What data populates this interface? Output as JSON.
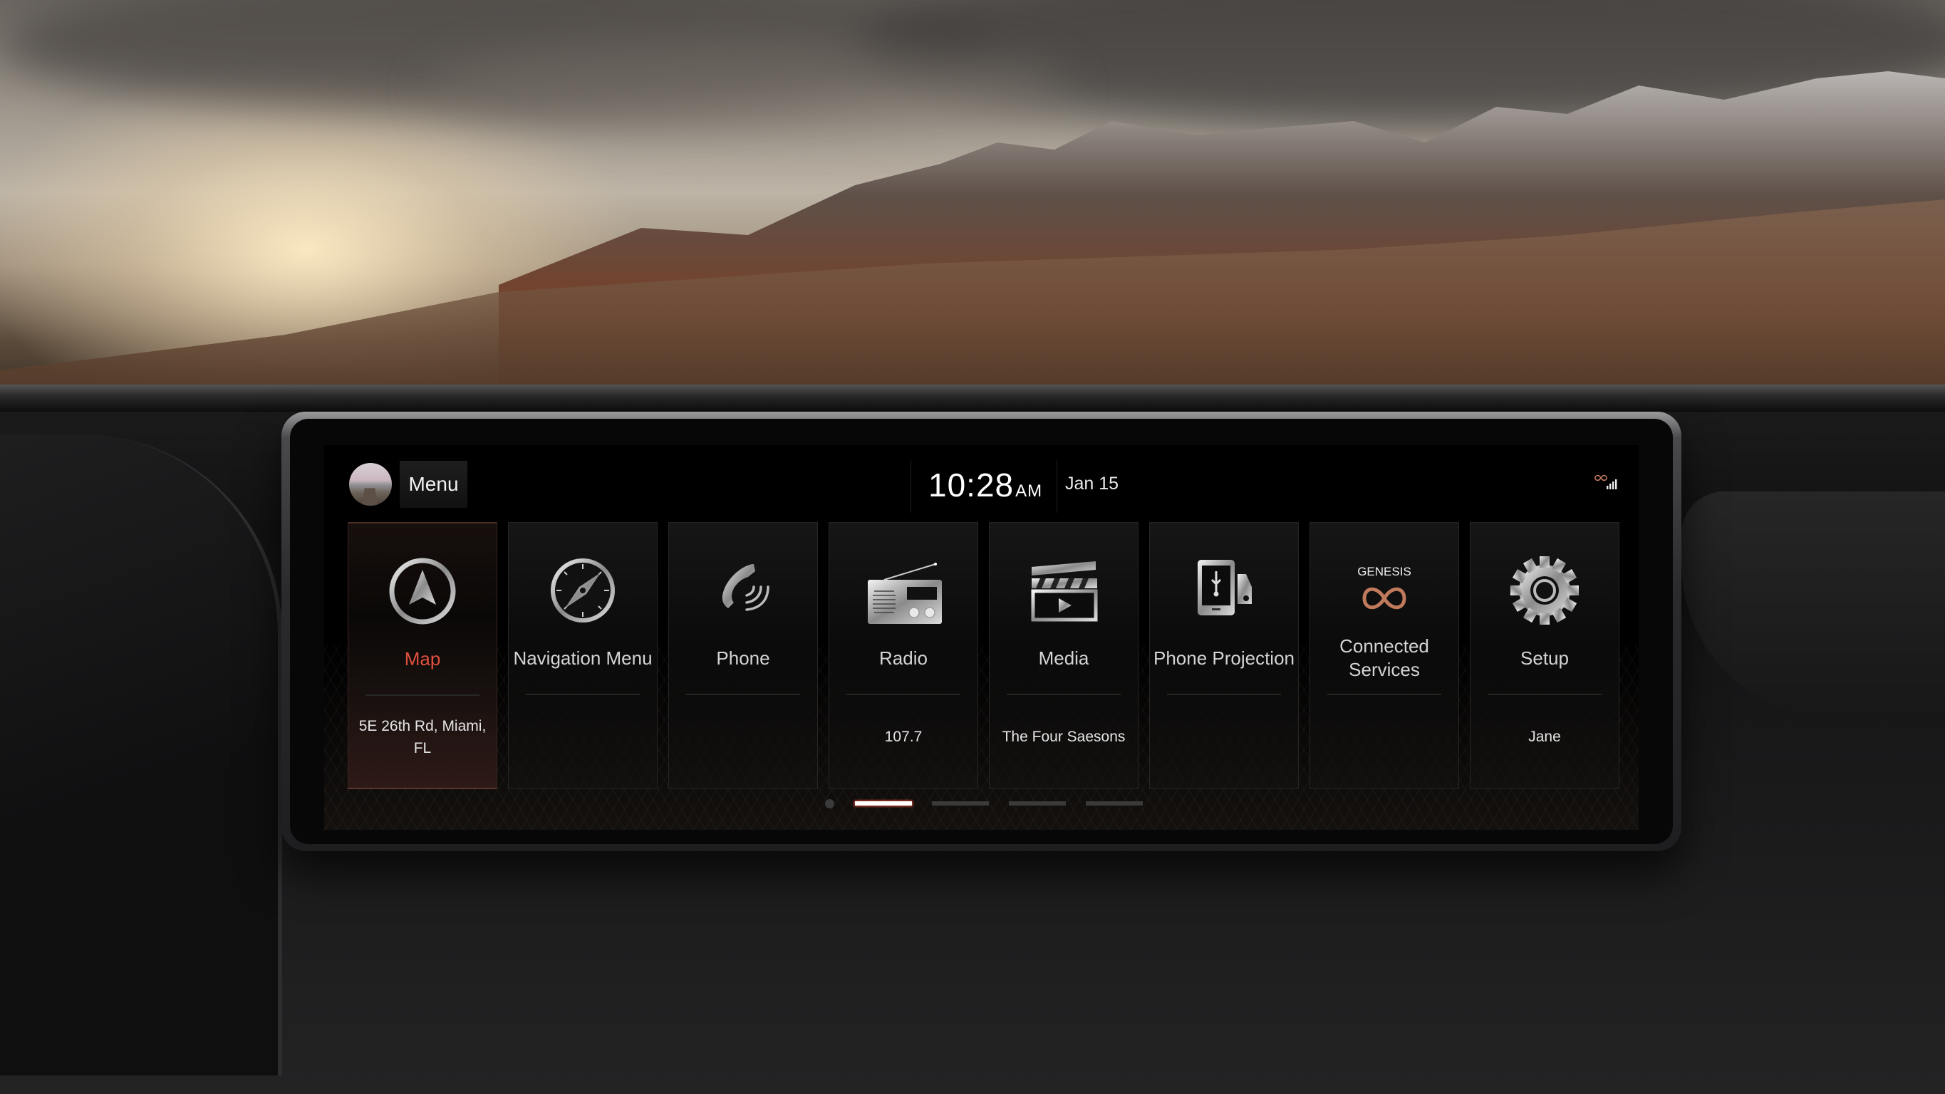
{
  "header": {
    "menu_label": "Menu",
    "time": "10:28",
    "ampm": "AM",
    "date": "Jan 15",
    "status_icons": [
      "genesis-connected-icon",
      "signal-strength-icon"
    ]
  },
  "tiles": [
    {
      "label": "Map",
      "sub": "5E 26th Rd, Miami, FL",
      "icon": "navigation-arrow-icon",
      "active": true
    },
    {
      "label": "Navigation Menu",
      "sub": "",
      "icon": "compass-icon",
      "active": false
    },
    {
      "label": "Phone",
      "sub": "",
      "icon": "phone-icon",
      "active": false
    },
    {
      "label": "Radio",
      "sub": "107.7",
      "icon": "radio-icon",
      "active": false
    },
    {
      "label": "Media",
      "sub": "The Four Saesons",
      "icon": "clapperboard-icon",
      "active": false
    },
    {
      "label": "Phone Projection",
      "sub": "",
      "icon": "phone-projection-icon",
      "active": false
    },
    {
      "label": "Connected Services",
      "sub": "",
      "icon": "genesis-connected-icon",
      "brand": "GENESIS",
      "active": false
    },
    {
      "label": "Setup",
      "sub": "Jane",
      "icon": "gear-icon",
      "active": false
    }
  ],
  "pager": {
    "pages": 4,
    "current": 1,
    "has_home_dot": true
  },
  "colors": {
    "accent": "#e0503f",
    "brand_copper": "#c07a5c"
  }
}
